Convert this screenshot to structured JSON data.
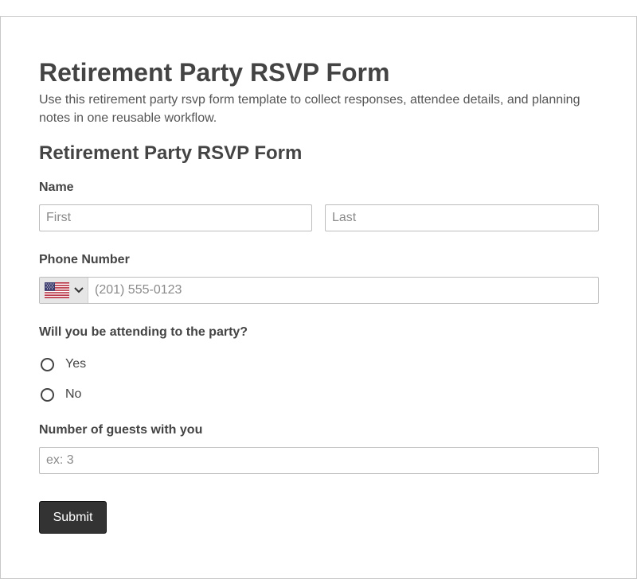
{
  "page": {
    "title": "Retirement Party RSVP Form",
    "description": "Use this retirement party rsvp form template to collect responses, attendee details, and planning notes in one reusable workflow."
  },
  "form": {
    "title": "Retirement Party RSVP Form",
    "name": {
      "label": "Name",
      "first_placeholder": "First",
      "last_placeholder": "Last"
    },
    "phone": {
      "label": "Phone Number",
      "country_icon": "us-flag-icon",
      "placeholder": "(201) 555-0123"
    },
    "attending": {
      "label": "Will you be attending to the party?",
      "options": [
        {
          "label": "Yes",
          "selected": false
        },
        {
          "label": "No",
          "selected": false
        }
      ]
    },
    "guests": {
      "label": "Number of guests with you",
      "placeholder": "ex: 3"
    },
    "submit_label": "Submit"
  },
  "colors": {
    "button_bg": "#333333",
    "text": "#444444",
    "border": "#bdbdbd"
  }
}
